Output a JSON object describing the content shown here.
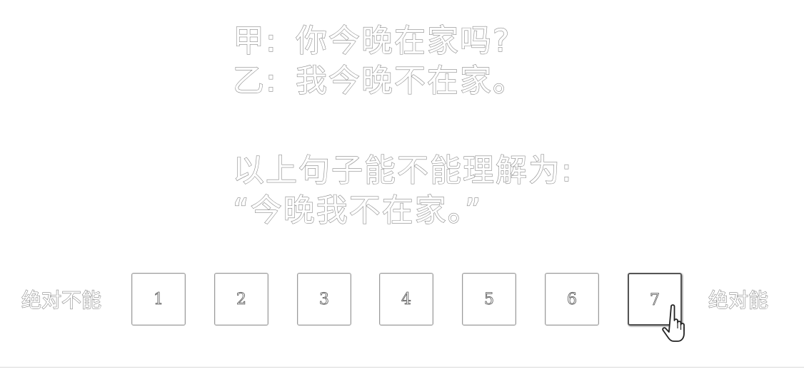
{
  "dialog": [
    {
      "speaker": "甲:",
      "text": "你今晚在家吗?"
    },
    {
      "speaker": "乙:",
      "text": "我今晚不在家。"
    }
  ],
  "question": {
    "prompt": "以上句子能不能理解为:",
    "paraphrase": "“今晚我不在家。”"
  },
  "scale": {
    "left_label": "绝对不能",
    "right_label": "绝对能",
    "options": [
      "1",
      "2",
      "3",
      "4",
      "5",
      "6",
      "7"
    ],
    "hovered_option": "7"
  },
  "colors": {
    "outline": "#8a8a8a",
    "border": "#9a9a9a",
    "background": "#ffffff"
  },
  "icons": {
    "cursor": "hand-pointer-icon"
  }
}
